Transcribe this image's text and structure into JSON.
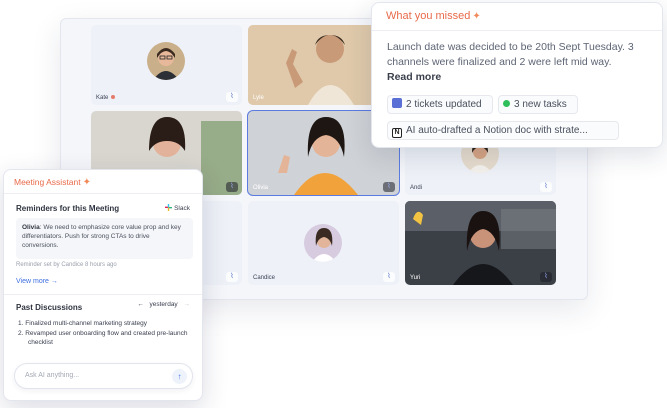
{
  "participants": [
    {
      "name": "Kate",
      "muted_dot": true
    },
    {
      "name": "Lyle"
    },
    {
      "name": ""
    },
    {
      "name": "Olivia"
    },
    {
      "name": "Andi"
    },
    {
      "name": ""
    },
    {
      "name": "Candice"
    },
    {
      "name": "Yuri"
    }
  ],
  "audio_icon": "audio-wave-icon",
  "missed": {
    "title": "What you missed",
    "summary": "Launch date was decided to be 20th Sept Tuesday. 3 channels were finalized and 2 were left mid way.",
    "read_more": "Read more",
    "chips": [
      {
        "label": "2 tickets updated",
        "icon": "ticket-icon",
        "color": "#5a6fd6"
      },
      {
        "label": "3 new tasks",
        "icon": "green-dot-icon",
        "color": "#2fbf5a"
      },
      {
        "label": "AI auto-drafted a Notion doc with strate...",
        "icon": "notion-icon",
        "color": "#222222"
      }
    ]
  },
  "assistant": {
    "title": "Meeting Assistant",
    "reminders_title": "Reminders for this Meeting",
    "slack_label": "Slack",
    "note_author": "Olivia",
    "note_text": ": We need to emphasize core value prop and key differentiators. Push for strong CTAs to drive conversions.",
    "reminder_meta": "Reminder set by Candice 8 hours ago",
    "view_more": "View more →",
    "past_title": "Past Discussions",
    "pager_prev": "←",
    "pager_label": "yesterday",
    "pager_next": "→",
    "past_items": [
      "1. Finalized multi-channel marketing strategy",
      "2. Revamped user onboarding flow and created pre-launch checklist"
    ],
    "ask_placeholder": "Ask AI anything...",
    "send_icon": "↑"
  },
  "colors": {
    "accent": "#e86a4a",
    "link": "#3d6fe0",
    "active_border": "#5b7be0"
  }
}
